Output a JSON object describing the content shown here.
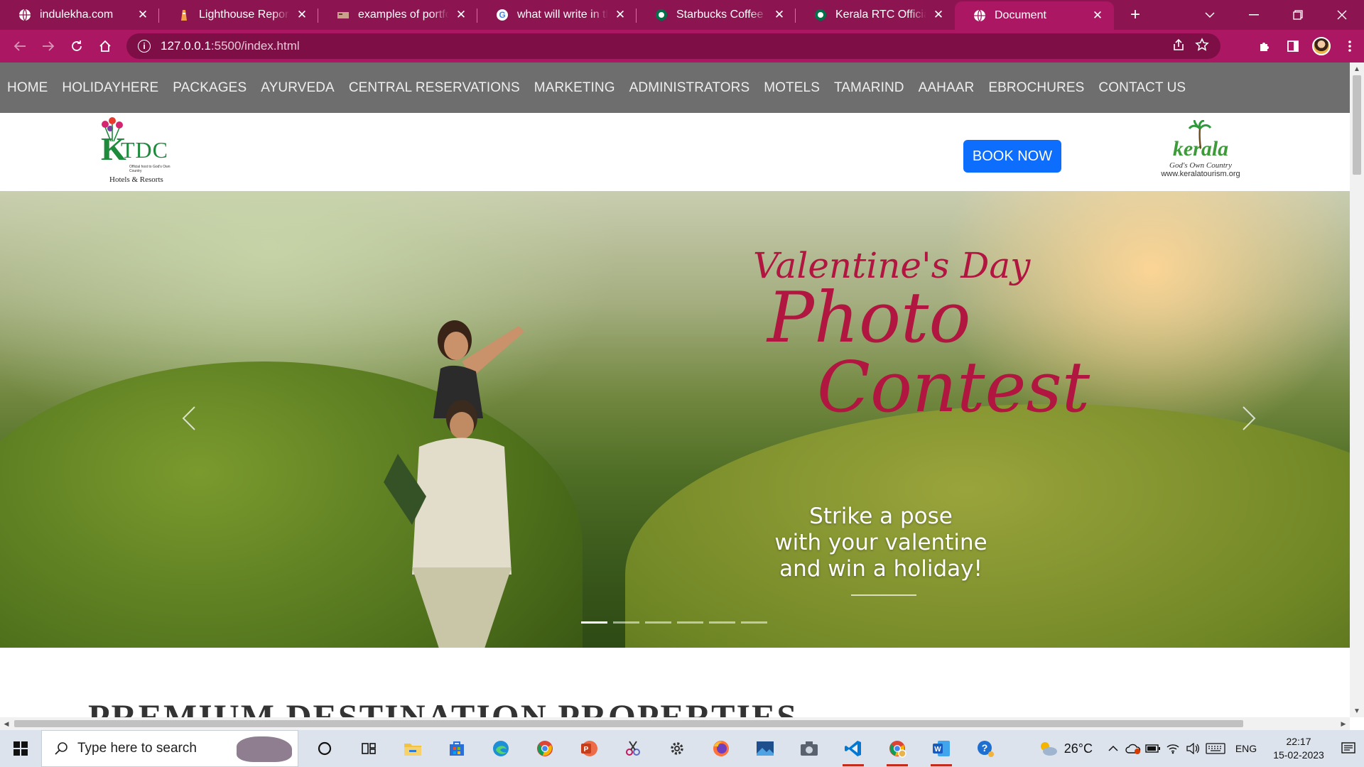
{
  "browser": {
    "tabs": [
      {
        "title": "indulekha.com",
        "icon": "globe-icon",
        "active": false
      },
      {
        "title": "Lighthouse Report Viewer",
        "icon": "lighthouse-icon",
        "active": false
      },
      {
        "title": "examples of portfolio",
        "icon": "image-favicon-icon",
        "active": false
      },
      {
        "title": "what will write in the p",
        "icon": "google-icon",
        "active": false
      },
      {
        "title": "Starbucks Coffee Company",
        "icon": "starbucks-icon",
        "active": false
      },
      {
        "title": "Kerala RTC Official Website",
        "icon": "starbucks-icon",
        "active": false
      },
      {
        "title": "Document",
        "icon": "globe-icon",
        "active": true
      }
    ],
    "url_host": "127.0.0.1",
    "url_rest": ":5500/index.html"
  },
  "site": {
    "nav": [
      "HOME",
      "HOLIDAYHERE",
      "PACKAGES",
      "AYURVEDA",
      "CENTRAL RESERVATIONS",
      "MARKETING",
      "ADMINISTRATORS",
      "MOTELS",
      "TAMARIND",
      "AAHAAR",
      "EBROCHURES",
      "CONTACT US"
    ],
    "logo_left": {
      "k": "K",
      "tdc": "TDC",
      "tagline": "Official host to God's Own Country",
      "sub": "Hotels & Resorts"
    },
    "book_now": "BOOK NOW",
    "logo_right": {
      "word": "kerala",
      "tagline": "God's Own Country",
      "url": "www.keralatourism.org"
    },
    "hero": {
      "title_line1": "Valentine's Day",
      "title_line2": "Photo",
      "title_line3": "Contest",
      "caption_line1": "Strike a pose",
      "caption_line2": "with your valentine",
      "caption_line3": "and win a holiday!",
      "slides": 6,
      "active_slide": 1
    },
    "section_title": "PREMIUM DESTINATION PROPERTIES"
  },
  "taskbar": {
    "search_placeholder": "Type here to search",
    "apps": [
      "cortana-icon",
      "task-view-icon",
      "file-explorer-icon",
      "store-icon",
      "edge-icon",
      "chrome-icon",
      "powerpoint-icon",
      "snip-icon",
      "settings-icon",
      "firefox-icon",
      "photos-icon",
      "camera-icon",
      "vscode-icon",
      "chrome-profile-icon",
      "word-icon",
      "help-icon"
    ],
    "weather": "26°C",
    "language": "ENG",
    "time": "22:17",
    "date": "15-02-2023"
  },
  "colors": {
    "tab_strip": "#8c1450",
    "toolbar": "#ab1763",
    "site_nav": "#6e6e6e",
    "book_button": "#0d6efd",
    "hero_title": "#b0163f"
  }
}
